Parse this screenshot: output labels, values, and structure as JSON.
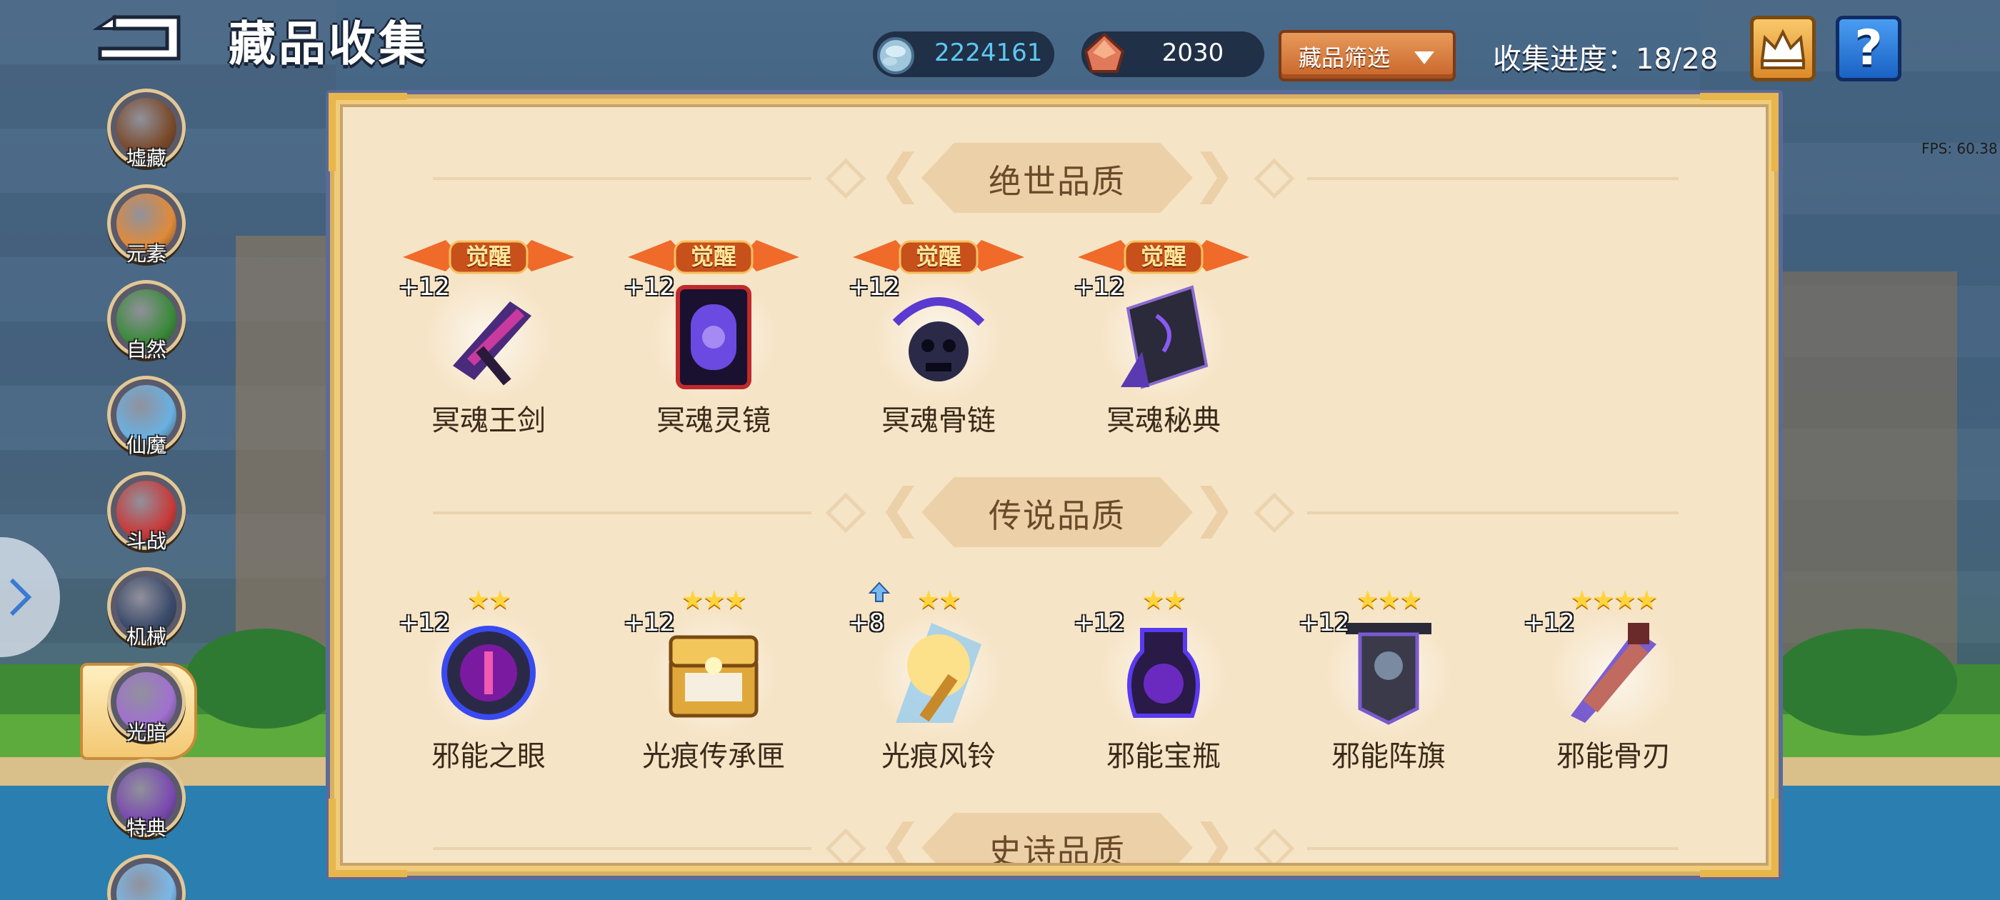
{
  "header": {
    "title": "藏品收集",
    "currency_gem": "2224161",
    "currency_ore": "2030",
    "filter_label": "藏品筛选",
    "progress_text": "收集进度：18/28",
    "help_glyph": "?",
    "fps_text": "FPS: 60.38"
  },
  "sidebar": {
    "items": [
      {
        "label": "墟藏",
        "color": "#7a4a2a",
        "active": false
      },
      {
        "label": "元素",
        "color": "#e08a3a",
        "active": false
      },
      {
        "label": "自然",
        "color": "#3a8a3a",
        "active": false
      },
      {
        "label": "仙魔",
        "color": "#6ab0e0",
        "active": false
      },
      {
        "label": "斗战",
        "color": "#c83a3a",
        "active": false
      },
      {
        "label": "机械",
        "color": "#3a4a6a",
        "active": false
      },
      {
        "label": "光暗",
        "color": "#a070d0",
        "active": true
      },
      {
        "label": "特典",
        "color": "#7a4ab0",
        "active": false
      },
      {
        "label": "",
        "color": "#7ab8e8",
        "active": false
      }
    ]
  },
  "sections": [
    {
      "title": "绝世品质",
      "items": [
        {
          "name": "冥魂王剑",
          "level": "+12",
          "awakened": true,
          "awaken_label": "觉醒",
          "stars": 0,
          "icon": "soul-sword-icon"
        },
        {
          "name": "冥魂灵镜",
          "level": "+12",
          "awakened": true,
          "awaken_label": "觉醒",
          "stars": 0,
          "icon": "soul-mirror-icon"
        },
        {
          "name": "冥魂骨链",
          "level": "+12",
          "awakened": true,
          "awaken_label": "觉醒",
          "stars": 0,
          "icon": "bone-chain-icon"
        },
        {
          "name": "冥魂秘典",
          "level": "+12",
          "awakened": true,
          "awaken_label": "觉醒",
          "stars": 0,
          "icon": "secret-tome-icon"
        }
      ]
    },
    {
      "title": "传说品质",
      "items": [
        {
          "name": "邪能之眼",
          "level": "+12",
          "awakened": false,
          "stars": 2,
          "star_text": "★★",
          "icon": "evil-eye-icon"
        },
        {
          "name": "光痕传承匣",
          "level": "+12",
          "awakened": false,
          "stars": 3,
          "star_text": "★★★",
          "icon": "light-chest-icon"
        },
        {
          "name": "光痕风铃",
          "level": "+8",
          "awakened": false,
          "stars": 2,
          "star_text": "★★",
          "upgradable": true,
          "icon": "wind-chime-icon"
        },
        {
          "name": "邪能宝瓶",
          "level": "+12",
          "awakened": false,
          "stars": 2,
          "star_text": "★★",
          "icon": "evil-vase-icon"
        },
        {
          "name": "邪能阵旗",
          "level": "+12",
          "awakened": false,
          "stars": 3,
          "star_text": "★★★",
          "icon": "evil-banner-icon"
        },
        {
          "name": "邪能骨刃",
          "level": "+12",
          "awakened": false,
          "stars": 4,
          "star_text": "★★★★",
          "icon": "bone-blade-icon"
        }
      ]
    },
    {
      "title": "史诗品质",
      "items": []
    }
  ],
  "colors": {
    "accent_orange": "#c8652b",
    "gem_text": "#5ec8f2",
    "panel_bg": "#f6e4c6",
    "section_title": "#6a4a2a",
    "star": "#ffd43b"
  }
}
